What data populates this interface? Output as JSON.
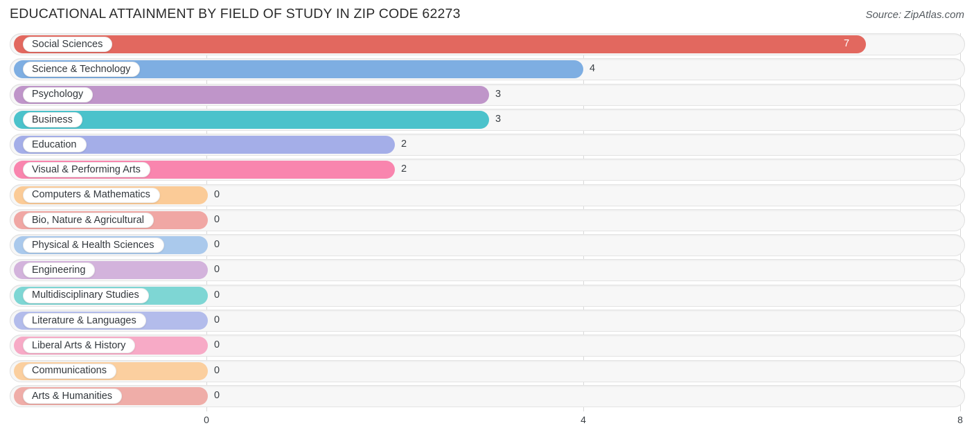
{
  "header": {
    "title": "EDUCATIONAL ATTAINMENT BY FIELD OF STUDY IN ZIP CODE 62273",
    "source": "Source: ZipAtlas.com"
  },
  "chart_data": {
    "type": "bar",
    "orientation": "horizontal",
    "title": "EDUCATIONAL ATTAINMENT BY FIELD OF STUDY IN ZIP CODE 62273",
    "xlabel": "",
    "ylabel": "",
    "xlim": [
      0,
      8
    ],
    "grid": true,
    "legend": "none",
    "xticks": [
      "0",
      "4",
      "8"
    ],
    "xtick_values": [
      0,
      4,
      8
    ],
    "categories": [
      "Social Sciences",
      "Science & Technology",
      "Psychology",
      "Business",
      "Education",
      "Visual & Performing Arts",
      "Computers & Mathematics",
      "Bio, Nature & Agricultural",
      "Physical & Health Sciences",
      "Engineering",
      "Multidisciplinary Studies",
      "Literature & Languages",
      "Liberal Arts & History",
      "Communications",
      "Arts & Humanities"
    ],
    "values": [
      7,
      4,
      3,
      3,
      2,
      2,
      0,
      0,
      0,
      0,
      0,
      0,
      0,
      0,
      0
    ],
    "value_labels": [
      "7",
      "4",
      "3",
      "3",
      "2",
      "2",
      "0",
      "0",
      "0",
      "0",
      "0",
      "0",
      "0",
      "0",
      "0"
    ],
    "colors": [
      "#e2685f",
      "#7eaee2",
      "#bf95c9",
      "#4bc2cb",
      "#a4aee8",
      "#f985ae",
      "#fbcb97",
      "#f0a7a4",
      "#aac9ec",
      "#d3b3dc",
      "#7ed6d4",
      "#b3bceb",
      "#f7aac6",
      "#fbcf9f",
      "#efada8"
    ]
  }
}
